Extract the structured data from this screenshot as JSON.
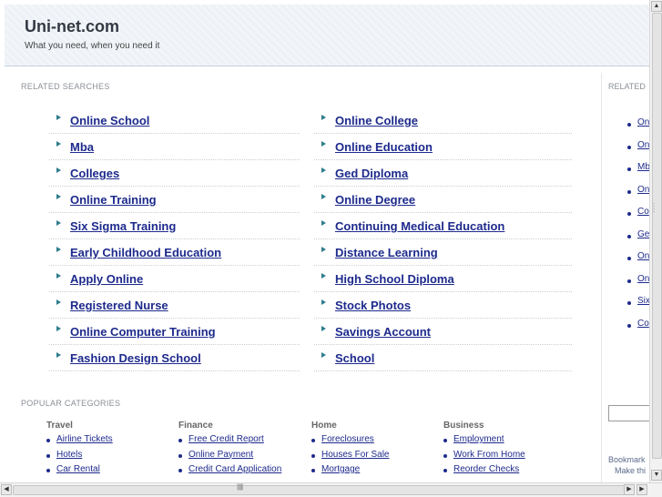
{
  "header": {
    "site_title": "Uni-net.com",
    "tagline": "What you need, when you need it"
  },
  "related_searches": {
    "label": "RELATED SEARCHES",
    "left": [
      "Online School",
      "Mba",
      "Colleges",
      "Online Training",
      "Six Sigma Training",
      "Early Childhood Education",
      "Apply Online",
      "Registered Nurse",
      "Online Computer Training",
      "Fashion Design School"
    ],
    "right": [
      "Online College",
      "Online Education",
      "Ged Diploma",
      "Online Degree",
      "Continuing Medical Education",
      "Distance Learning",
      "High School Diploma",
      "Stock Photos",
      "Savings Account",
      "School"
    ]
  },
  "popular_categories": {
    "label": "POPULAR CATEGORIES",
    "categories": [
      {
        "title": "Travel",
        "items": [
          "Airline Tickets",
          "Hotels",
          "Car Rental"
        ]
      },
      {
        "title": "Finance",
        "items": [
          "Free Credit Report",
          "Online Payment",
          "Credit Card Application"
        ]
      },
      {
        "title": "Home",
        "items": [
          "Foreclosures",
          "Houses For Sale",
          "Mortgage"
        ]
      },
      {
        "title": "Business",
        "items": [
          "Employment",
          "Work From Home",
          "Reorder Checks"
        ]
      }
    ]
  },
  "sidebar": {
    "label": "RELATED",
    "items": [
      "On",
      "On",
      "Mb",
      "On",
      "Co",
      "Ge",
      "On",
      "On",
      "Six",
      "Co"
    ],
    "bookmark": "Bookmark",
    "make": "Make thi"
  },
  "colors": {
    "link": "#1d2a8c",
    "arrow": "#2e7d8c",
    "header_bg": "#eef2f7"
  }
}
